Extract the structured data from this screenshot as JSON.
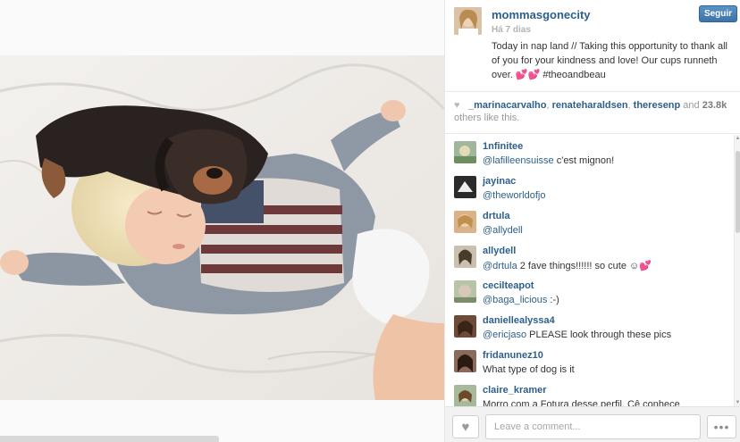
{
  "post": {
    "username": "mommasgonecity",
    "time": "Há 7 dias",
    "follow_label": "Seguir",
    "caption": "Today in nap land // Taking this opportunity to thank all of you for your kindness and love! Our cups runneth over. 💕💕 #theoandbeau"
  },
  "likes": {
    "likers": [
      "_marinacarvalho",
      "renateharaldsen",
      "theresenp"
    ],
    "separator": ", ",
    "and_text": " and ",
    "count": "23.8k",
    "suffix": " others like this."
  },
  "comments": [
    {
      "user": "1nfinitee",
      "mention": "@lafilleensuisse",
      "text": " c'est mignon!",
      "avatar_color": "#9fb79a"
    },
    {
      "user": "jayinac",
      "mention": "@theworldofjo",
      "text": "",
      "avatar_color": "#2b2b2b"
    },
    {
      "user": "drtula",
      "mention": "@allydell",
      "text": "",
      "avatar_color": "#c8a27a"
    },
    {
      "user": "allydell",
      "mention": "@drtula",
      "text": " 2 fave things!!!!!! so cute ☺💕",
      "avatar_color": "#5a4a3a"
    },
    {
      "user": "cecilteapot",
      "mention": "@baga_licious",
      "text": " :-)",
      "avatar_color": "#b8c4a8"
    },
    {
      "user": "daniellealyssa4",
      "mention": "@ericjaso",
      "text": " PLEASE look through these pics",
      "avatar_color": "#6e4a38"
    },
    {
      "user": "fridanunez10",
      "mention": "",
      "text": "What type of dog is it",
      "avatar_color": "#7a5a4a"
    },
    {
      "user": "claire_kramer",
      "mention": "",
      "text": "Morro com a Fotura desse perfil. Cê conhece",
      "avatar_color": "#8aa07a"
    }
  ],
  "footer": {
    "placeholder": "Leave a comment...",
    "like_icon": "heart-icon",
    "more_icon": "ellipsis-icon"
  },
  "colors": {
    "link": "#2d5f8b",
    "follow_button": "#4a82b8",
    "muted": "#b3b3b3"
  }
}
